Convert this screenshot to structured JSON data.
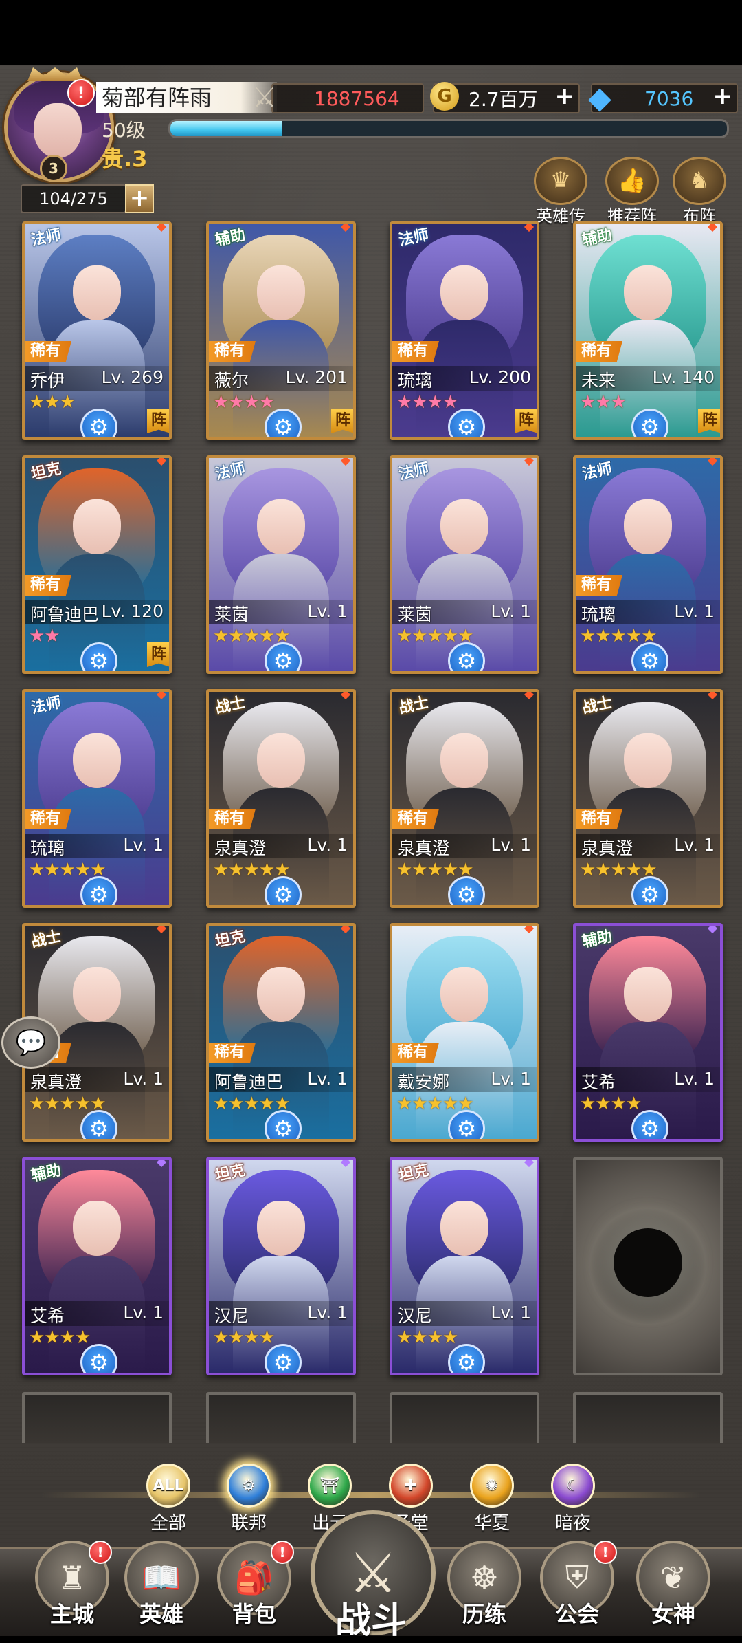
{
  "player": {
    "name": "菊部有阵雨",
    "level_label": "50级",
    "vip_label": "贵.3",
    "avatar_level": "3",
    "alert": "!",
    "exp_fraction": 0.2
  },
  "resources": {
    "power": "1887564",
    "gold": "2.7百万",
    "diamonds": "7036"
  },
  "roster": {
    "capacity": "104/275"
  },
  "top_buttons": [
    {
      "label": "英雄传",
      "icon": "crown-icon"
    },
    {
      "label": "推荐阵",
      "icon": "thumbs-up-icon"
    },
    {
      "label": "布阵",
      "icon": "chess-knight-icon"
    }
  ],
  "heroes": [
    {
      "class": "法师",
      "rarity": "稀有",
      "name": "乔伊",
      "level": "Lv. 269",
      "stars": "★★★",
      "star_color": "gold",
      "in_team": true,
      "team_label": "阵",
      "frame": "gold"
    },
    {
      "class": "辅助",
      "rarity": "稀有",
      "name": "薇尔",
      "level": "Lv. 201",
      "stars": "★★★★",
      "star_color": "pink",
      "in_team": true,
      "team_label": "阵",
      "frame": "gold"
    },
    {
      "class": "法师",
      "rarity": "稀有",
      "name": "琉璃",
      "level": "Lv. 200",
      "stars": "★★★★",
      "star_color": "pink",
      "in_team": true,
      "team_label": "阵",
      "frame": "gold"
    },
    {
      "class": "辅助",
      "rarity": "稀有",
      "name": "未来",
      "level": "Lv. 140",
      "stars": "★★★",
      "star_color": "pink",
      "in_team": true,
      "team_label": "阵",
      "frame": "gold"
    },
    {
      "class": "坦克",
      "rarity": "稀有",
      "name": "阿鲁迪巴",
      "level": "Lv. 120",
      "stars": "★★",
      "star_color": "pink",
      "in_team": true,
      "team_label": "阵",
      "frame": "gold"
    },
    {
      "class": "法师",
      "rarity": "",
      "name": "莱茵",
      "level": "Lv. 1",
      "stars": "★★★★★",
      "star_color": "gold",
      "in_team": false,
      "team_label": "",
      "frame": "gold"
    },
    {
      "class": "法师",
      "rarity": "",
      "name": "莱茵",
      "level": "Lv. 1",
      "stars": "★★★★★",
      "star_color": "gold",
      "in_team": false,
      "team_label": "",
      "frame": "gold"
    },
    {
      "class": "法师",
      "rarity": "稀有",
      "name": "琉璃",
      "level": "Lv. 1",
      "stars": "★★★★★",
      "star_color": "gold",
      "in_team": false,
      "team_label": "",
      "frame": "gold"
    },
    {
      "class": "法师",
      "rarity": "稀有",
      "name": "琉璃",
      "level": "Lv. 1",
      "stars": "★★★★★",
      "star_color": "gold",
      "in_team": false,
      "team_label": "",
      "frame": "gold"
    },
    {
      "class": "战士",
      "rarity": "稀有",
      "name": "泉真澄",
      "level": "Lv. 1",
      "stars": "★★★★★",
      "star_color": "gold",
      "in_team": false,
      "team_label": "",
      "frame": "gold"
    },
    {
      "class": "战士",
      "rarity": "稀有",
      "name": "泉真澄",
      "level": "Lv. 1",
      "stars": "★★★★★",
      "star_color": "gold",
      "in_team": false,
      "team_label": "",
      "frame": "gold"
    },
    {
      "class": "战士",
      "rarity": "稀有",
      "name": "泉真澄",
      "level": "Lv. 1",
      "stars": "★★★★★",
      "star_color": "gold",
      "in_team": false,
      "team_label": "",
      "frame": "gold"
    },
    {
      "class": "战士",
      "rarity": "稀有",
      "name": "泉真澄",
      "level": "Lv. 1",
      "stars": "★★★★★",
      "star_color": "gold",
      "in_team": false,
      "team_label": "",
      "frame": "gold"
    },
    {
      "class": "坦克",
      "rarity": "稀有",
      "name": "阿鲁迪巴",
      "level": "Lv. 1",
      "stars": "★★★★★",
      "star_color": "gold",
      "in_team": false,
      "team_label": "",
      "frame": "gold"
    },
    {
      "class": "",
      "rarity": "稀有",
      "name": "戴安娜",
      "level": "Lv. 1",
      "stars": "★★★★★",
      "star_color": "gold",
      "in_team": false,
      "team_label": "",
      "frame": "gold"
    },
    {
      "class": "辅助",
      "rarity": "",
      "name": "艾希",
      "level": "Lv. 1",
      "stars": "★★★★",
      "star_color": "gold",
      "in_team": false,
      "team_label": "",
      "frame": "purple"
    },
    {
      "class": "辅助",
      "rarity": "",
      "name": "艾希",
      "level": "Lv. 1",
      "stars": "★★★★",
      "star_color": "gold",
      "in_team": false,
      "team_label": "",
      "frame": "purple"
    },
    {
      "class": "坦克",
      "rarity": "",
      "name": "汉尼",
      "level": "Lv. 1",
      "stars": "★★★★",
      "star_color": "gold",
      "in_team": false,
      "team_label": "",
      "frame": "purple"
    },
    {
      "class": "坦克",
      "rarity": "",
      "name": "汉尼",
      "level": "Lv. 1",
      "stars": "★★★★",
      "star_color": "gold",
      "in_team": false,
      "team_label": "",
      "frame": "purple"
    }
  ],
  "filters": [
    {
      "label": "全部",
      "icon_text": "ALL",
      "icon": "all-icon",
      "color": "#e7c56a",
      "active": false
    },
    {
      "label": "联邦",
      "icon_text": "⚙",
      "icon": "federation-gear-icon",
      "color": "#2f7fd9",
      "active": true
    },
    {
      "label": "出云",
      "icon_text": "⛩",
      "icon": "izumo-torii-icon",
      "color": "#2ea84a",
      "active": false
    },
    {
      "label": "圣堂",
      "icon_text": "✚",
      "icon": "sanctuary-cross-icon",
      "color": "#d2462a",
      "active": false
    },
    {
      "label": "华夏",
      "icon_text": "✺",
      "icon": "huaxia-sun-icon",
      "color": "#e9a21c",
      "active": false
    },
    {
      "label": "暗夜",
      "icon_text": "☾",
      "icon": "night-moon-icon",
      "color": "#8a4ad0",
      "active": false
    }
  ],
  "nav": [
    {
      "label": "主城",
      "icon": "castle-icon",
      "glyph": "♜",
      "alert": true
    },
    {
      "label": "英雄",
      "icon": "book-icon",
      "glyph": "📖",
      "alert": false
    },
    {
      "label": "背包",
      "icon": "backpack-icon",
      "glyph": "🎒",
      "alert": true
    },
    {
      "label": "战斗",
      "icon": "crossed-swords-icon",
      "glyph": "⚔",
      "alert": false
    },
    {
      "label": "历练",
      "icon": "ship-wheel-icon",
      "glyph": "☸",
      "alert": false
    },
    {
      "label": "公会",
      "icon": "guild-shield-icon",
      "glyph": "⛨",
      "alert": true
    },
    {
      "label": "女神",
      "icon": "goddess-wings-icon",
      "glyph": "❦",
      "alert": false
    }
  ],
  "colors": {
    "card_gold": "#c18a3c",
    "card_purple": "#8b4fd6",
    "power_text": "#ff5b5b",
    "diamond_text": "#55c6ff",
    "gold_text": "#ffffff"
  }
}
